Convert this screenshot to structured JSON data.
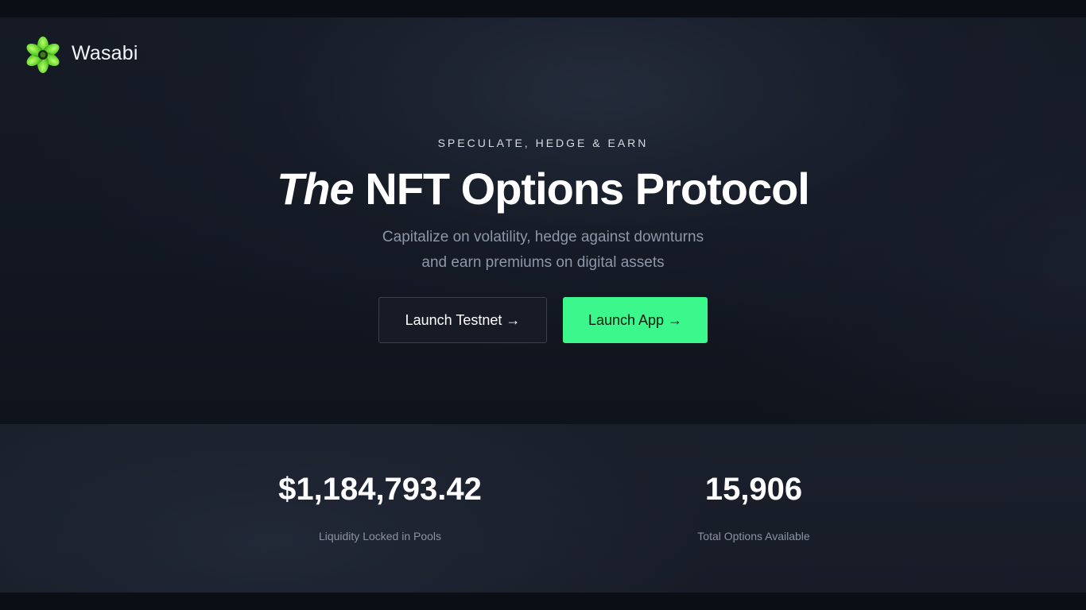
{
  "brand": {
    "name": "Wasabi",
    "logo_icon": "wasabi-flower-logo",
    "logo_color": "#6fe03a"
  },
  "hero": {
    "eyebrow": "SPECULATE, HEDGE & EARN",
    "headline_emphasis": "The",
    "headline_rest": " NFT Options Protocol",
    "subtitle_line1": "Capitalize on volatility, hedge against downturns",
    "subtitle_line2": "and earn premiums on digital assets"
  },
  "actions": {
    "testnet_label": "Launch Testnet →",
    "app_label": "Launch App →",
    "accent_color": "#3cf88c"
  },
  "stats": [
    {
      "value": "$1,184,793.42",
      "label": "Liquidity Locked in Pools"
    },
    {
      "value": "15,906",
      "label": "Total Options Available"
    }
  ]
}
